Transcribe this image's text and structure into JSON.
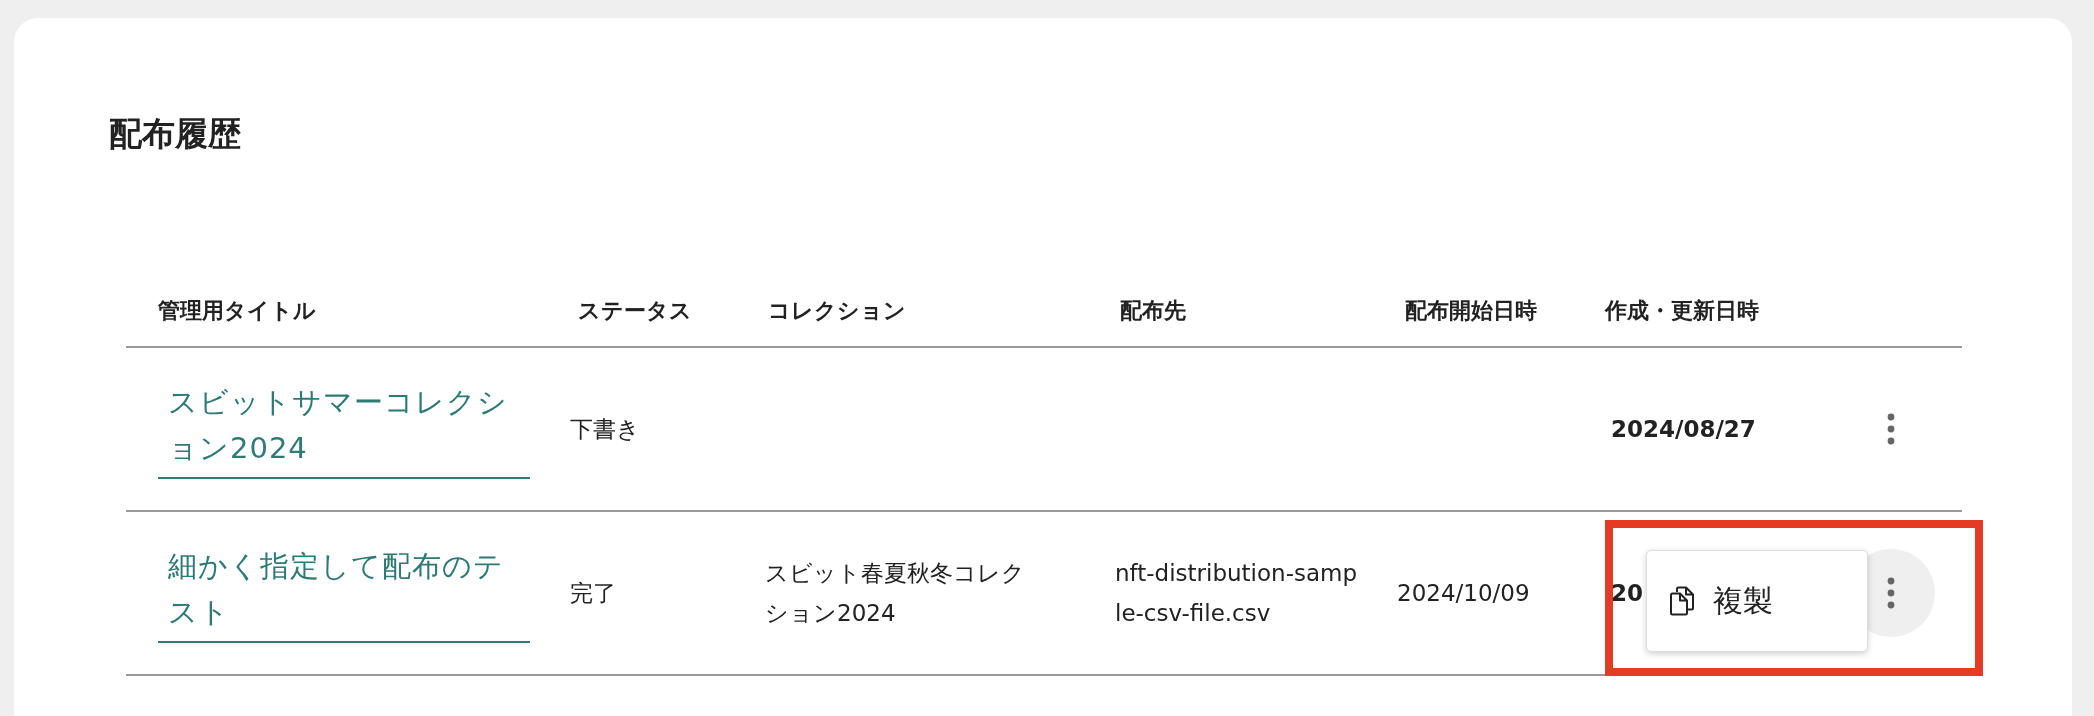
{
  "title": "配布履歴",
  "table": {
    "columns": [
      "管理用タイトル",
      "ステータス",
      "コレクション",
      "配布先",
      "配布開始日時",
      "作成・更新日時"
    ],
    "rows": [
      {
        "title": "スビットサマーコレクション2024",
        "status": "下書き",
        "collection": "",
        "destination": "",
        "start": "",
        "updated": "2024/08/27",
        "menu_open": false
      },
      {
        "title": "細かく指定して配布のテスト",
        "status": "完了",
        "collection": "スビット春夏秋冬コレクション2024",
        "destination": "nft-distribution-sample-csv-file.csv",
        "start": "2024/10/09",
        "updated": "20",
        "menu_open": true,
        "menu": {
          "items": [
            {
              "label": "複製"
            }
          ],
          "highlighted": true
        }
      }
    ]
  }
}
